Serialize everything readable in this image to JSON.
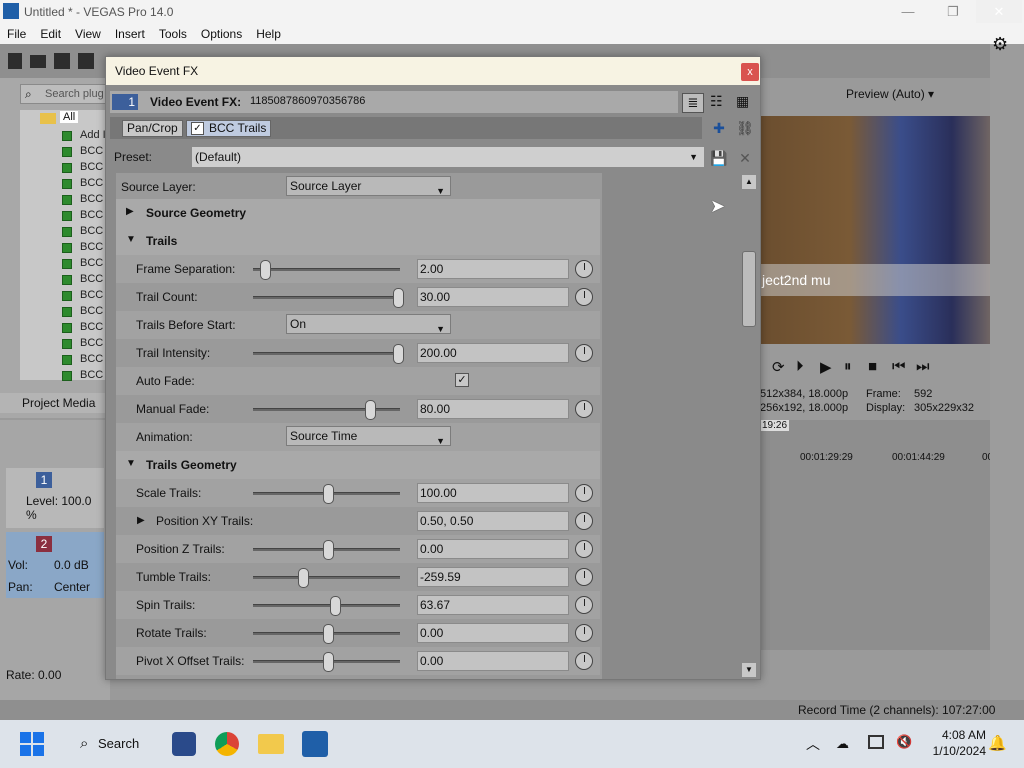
{
  "window": {
    "title": "Untitled * - VEGAS Pro 14.0"
  },
  "menu": [
    "File",
    "Edit",
    "View",
    "Insert",
    "Tools",
    "Options",
    "Help"
  ],
  "left_panel": {
    "search_placeholder": "Search plug",
    "tree_root": "All",
    "tree_items": [
      "Add I",
      "BCC",
      "BCC",
      "BCC",
      "BCC",
      "BCC",
      "BCC",
      "BCC",
      "BCC",
      "BCC",
      "BCC",
      "BCC",
      "BCC",
      "BCC",
      "BCC",
      "BCC"
    ],
    "tab_label": "Project Media"
  },
  "tracks": {
    "track1": {
      "number": "1",
      "level_label": "Level: 100.0 %"
    },
    "track2": {
      "number": "2",
      "vol_label": "Vol:",
      "vol_value": "0.0 dB",
      "pan_label": "Pan:",
      "pan_value": "Center"
    },
    "rate": "Rate: 0.00"
  },
  "preview": {
    "mode": "Preview (Auto)",
    "overlay_text": "ject2nd mu",
    "info_project": "512x384, 18.000p",
    "info_preview": "256x192, 18.000p",
    "frame_label": "Frame:",
    "frame_value": "592",
    "display_label": "Display:",
    "display_value": "305x229x32"
  },
  "timeline": {
    "marker": "19:26",
    "times": [
      "00:01:29:29",
      "00:01:44:29",
      "00:0"
    ]
  },
  "status": {
    "record_time": "Record Time (2 channels): 107:27:00"
  },
  "taskbar": {
    "search_label": "Search",
    "time": "4:08 AM",
    "date": "1/10/2024"
  },
  "dialog": {
    "title": "Video Event FX",
    "close": "x",
    "header_index": "1",
    "header_label": "Video Event FX:",
    "header_id": "1185087860970356786",
    "chain": [
      "Pan/Crop",
      "BCC Trails"
    ],
    "preset_label": "Preset:",
    "preset_value": "(Default)",
    "params": {
      "source_layer": {
        "label": "Source Layer:",
        "value": "Source Layer"
      },
      "source_geometry": "Source Geometry",
      "trails": "Trails",
      "frame_separation": {
        "label": "Frame Separation:",
        "value": "2.00",
        "pos": 0.05
      },
      "trail_count": {
        "label": "Trail Count:",
        "value": "30.00",
        "pos": 1.0
      },
      "trails_before_start": {
        "label": "Trails Before Start:",
        "value": "On"
      },
      "trail_intensity": {
        "label": "Trail Intensity:",
        "value": "200.00",
        "pos": 1.0
      },
      "auto_fade": {
        "label": "Auto Fade:",
        "checked": "✓"
      },
      "manual_fade": {
        "label": "Manual Fade:",
        "value": "80.00",
        "pos": 0.8
      },
      "animation": {
        "label": "Animation:",
        "value": "Source Time"
      },
      "trails_geometry": "Trails Geometry",
      "scale_trails": {
        "label": "Scale Trails:",
        "value": "100.00",
        "pos": 0.5
      },
      "position_xy": {
        "label": "Position XY Trails:",
        "value": "0.50, 0.50"
      },
      "position_z": {
        "label": "Position Z Trails:",
        "value": "0.00",
        "pos": 0.5
      },
      "tumble": {
        "label": "Tumble Trails:",
        "value": "-259.59",
        "pos": 0.32
      },
      "spin": {
        "label": "Spin Trails:",
        "value": "63.67",
        "pos": 0.55
      },
      "rotate": {
        "label": "Rotate Trails:",
        "value": "0.00",
        "pos": 0.5
      },
      "pivot_x": {
        "label": "Pivot X Offset Trails:",
        "value": "0.00",
        "pos": 0.5
      }
    }
  }
}
